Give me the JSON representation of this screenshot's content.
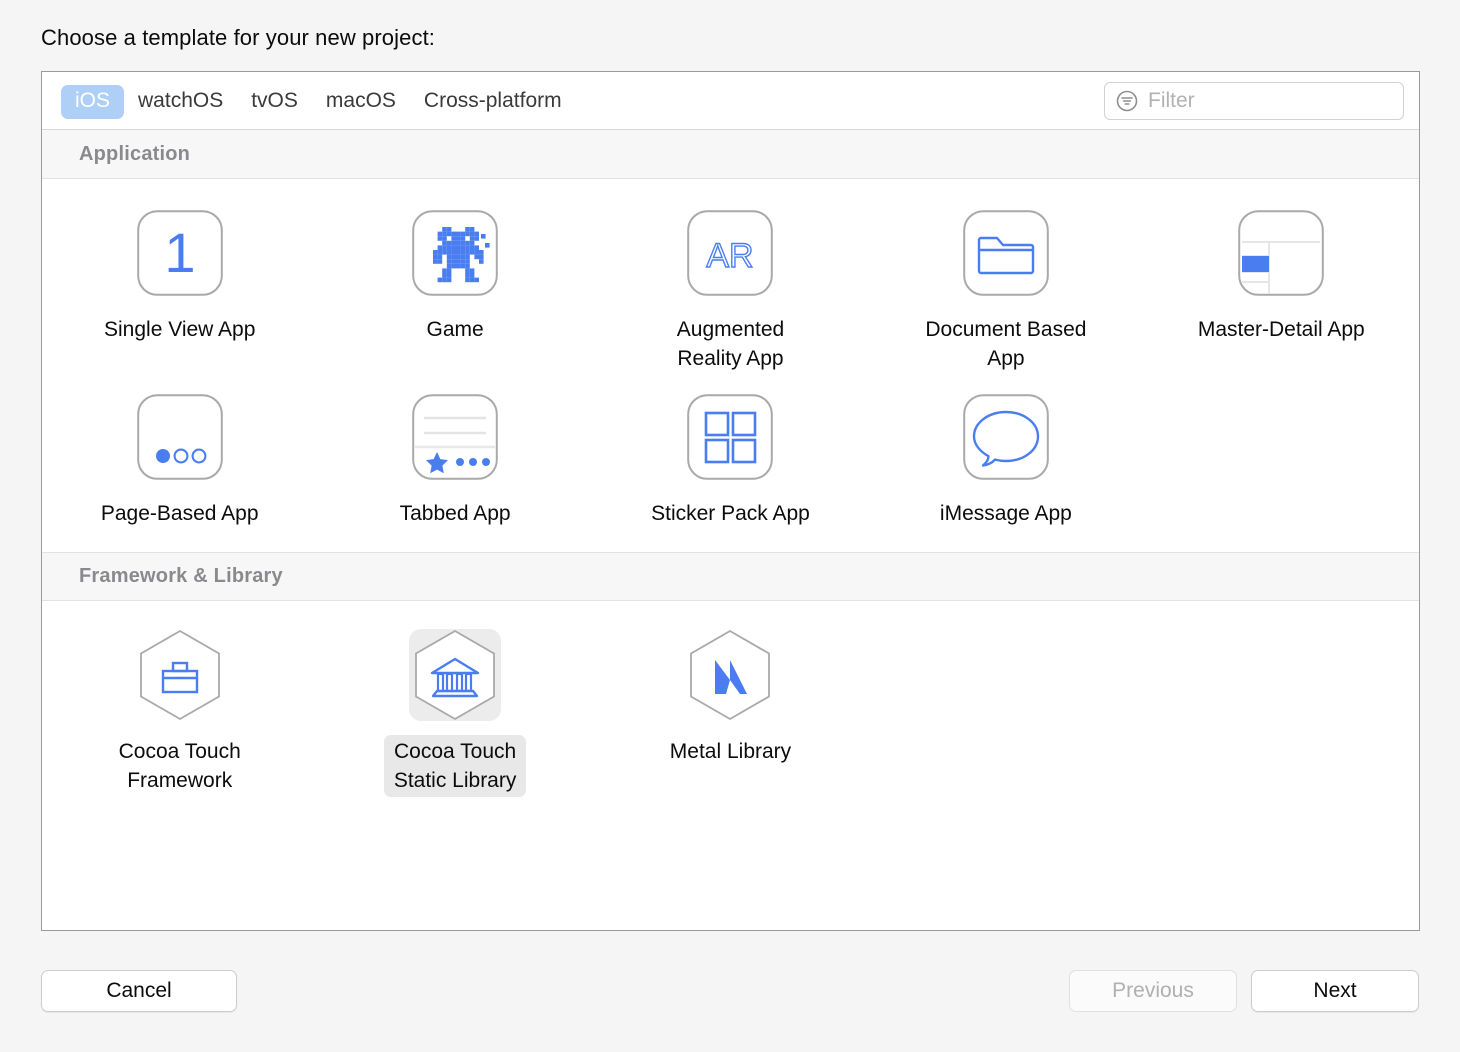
{
  "prompt": "Choose a template for your new project:",
  "toolbar": {
    "tabs": [
      {
        "label": "iOS",
        "selected": true
      },
      {
        "label": "watchOS",
        "selected": false
      },
      {
        "label": "tvOS",
        "selected": false
      },
      {
        "label": "macOS",
        "selected": false
      },
      {
        "label": "Cross-platform",
        "selected": false
      }
    ],
    "filter": {
      "placeholder": "Filter",
      "value": "",
      "icon": "filter-icon"
    }
  },
  "sections": [
    {
      "title": "Application",
      "templates": [
        {
          "label": "Single View App",
          "icon": "number-one-icon",
          "selected": false
        },
        {
          "label": "Game",
          "icon": "robot-sprite-icon",
          "selected": false
        },
        {
          "label": "Augmented\nReality App",
          "icon": "ar-text-icon",
          "selected": false
        },
        {
          "label": "Document Based\nApp",
          "icon": "folder-icon",
          "selected": false
        },
        {
          "label": "Master-Detail App",
          "icon": "split-view-icon",
          "selected": false
        },
        {
          "label": "Page-Based App",
          "icon": "page-dots-icon",
          "selected": false
        },
        {
          "label": "Tabbed App",
          "icon": "tab-bar-icon",
          "selected": false
        },
        {
          "label": "Sticker Pack App",
          "icon": "four-squares-icon",
          "selected": false
        },
        {
          "label": "iMessage App",
          "icon": "speech-bubble-icon",
          "selected": false
        }
      ]
    },
    {
      "title": "Framework & Library",
      "templates": [
        {
          "label": "Cocoa Touch\nFramework",
          "icon": "hexagon-briefcase-icon",
          "selected": false
        },
        {
          "label": "Cocoa Touch\nStatic Library",
          "icon": "hexagon-bank-icon",
          "selected": true
        },
        {
          "label": "Metal Library",
          "icon": "hexagon-metal-m-icon",
          "selected": false
        }
      ]
    }
  ],
  "footer": {
    "cancel": "Cancel",
    "previous": "Previous",
    "next": "Next"
  },
  "colors": {
    "accent_blue": "#4a7ef0",
    "tab_selected_bg": "#aed0f7",
    "panel_border": "#9a9a9a",
    "section_header_text": "#8a8a8e",
    "window_bg": "#f5f5f5",
    "selected_tile_bg": "#ececec"
  }
}
